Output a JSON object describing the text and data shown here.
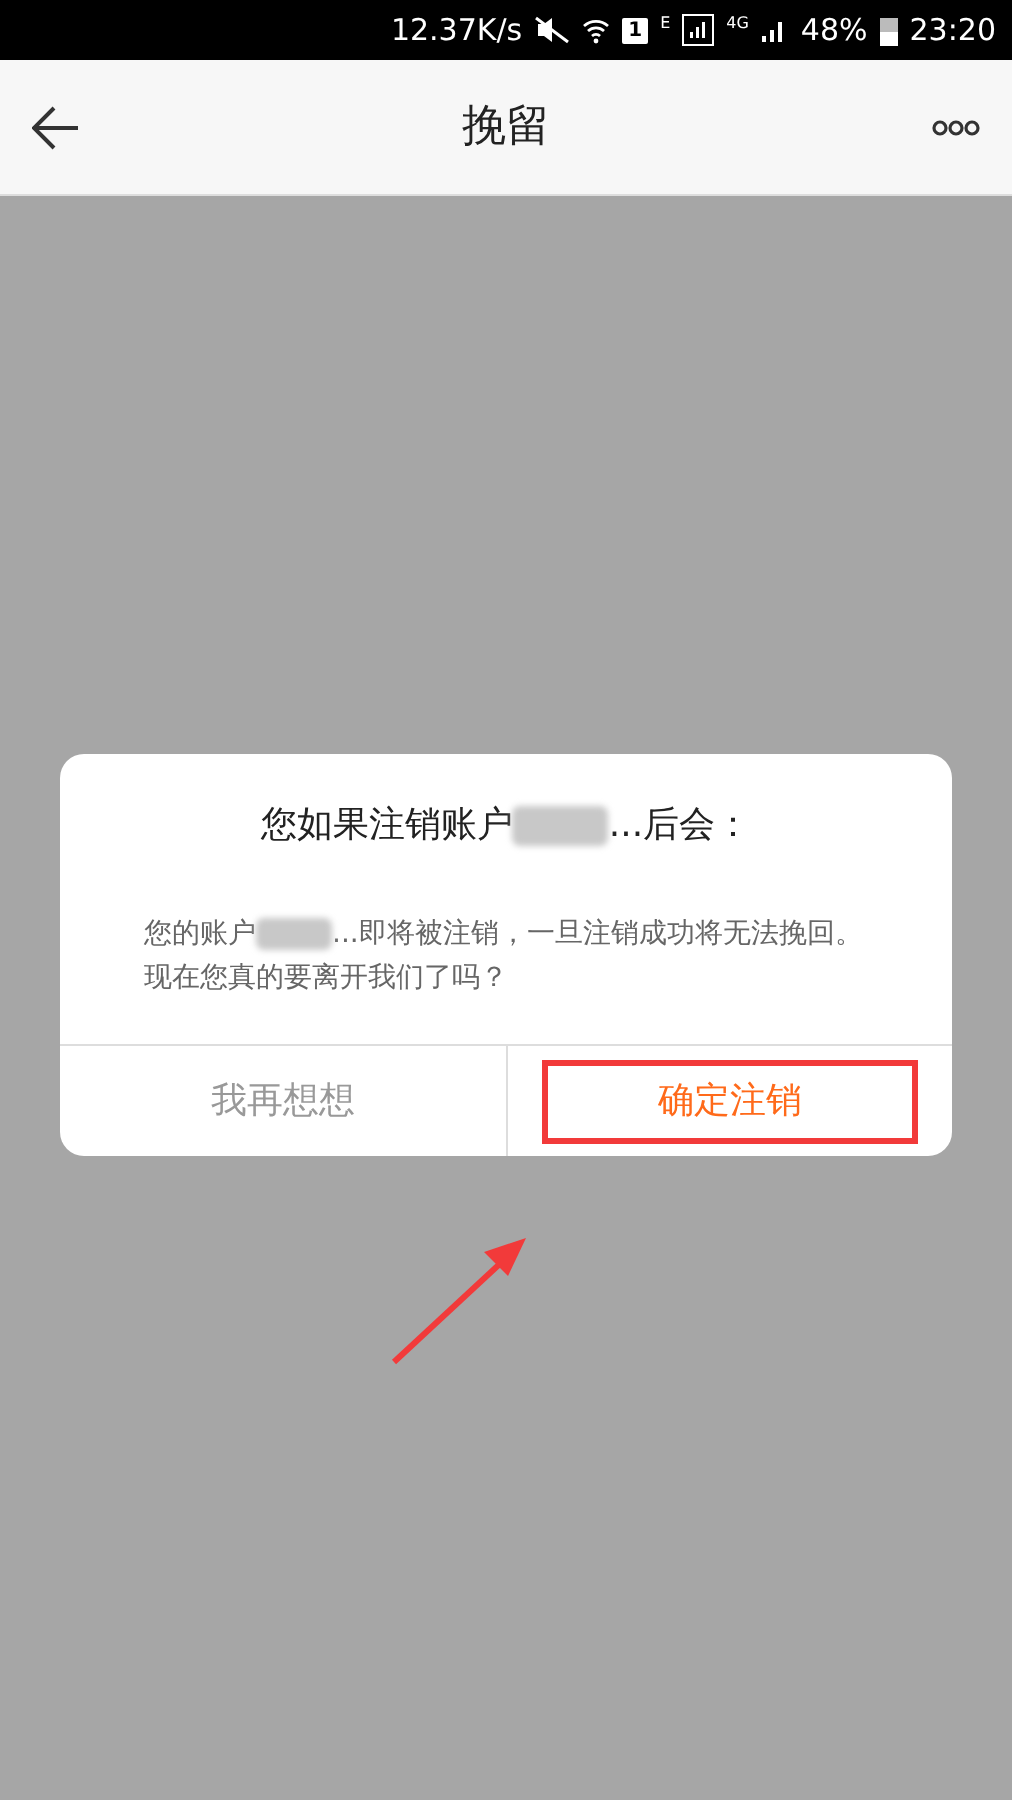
{
  "status_bar": {
    "speed": "12.37K/s",
    "sim_slot": "1",
    "network_e": "E",
    "network_4g": "4G",
    "battery": "48%",
    "time": "23:20"
  },
  "header": {
    "title": "挽留"
  },
  "dialog": {
    "title_before": "您如果注销账户",
    "title_after": "...后会：",
    "body_before": "您的账户",
    "body_after": "...即将被注销，一旦注销成功将无法挽回。",
    "body_question": "现在您真的要离开我们了吗？",
    "buttons": [
      {
        "label": "我再想想",
        "kind": "cancel",
        "highlighted": false
      },
      {
        "label": "确定注销",
        "kind": "confirm",
        "highlighted": true
      }
    ]
  }
}
